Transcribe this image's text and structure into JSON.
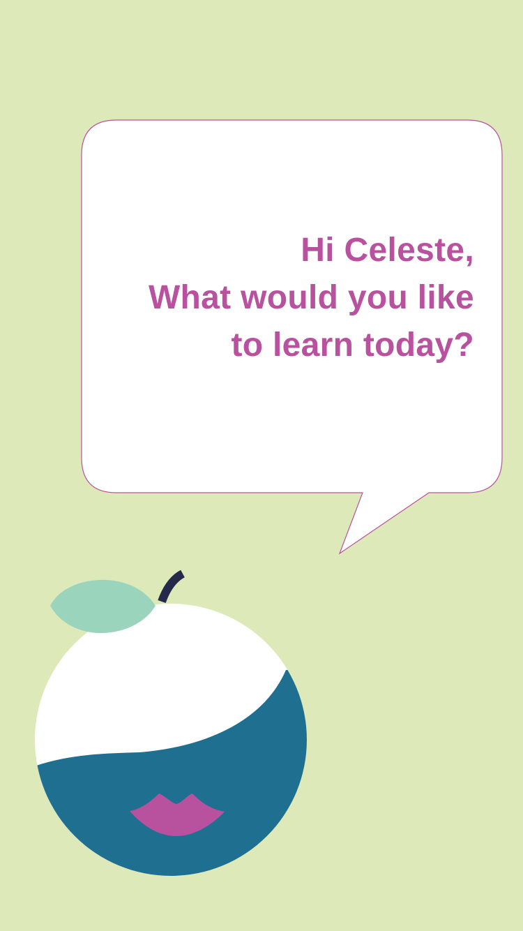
{
  "greeting": {
    "line1": "Hi Celeste,",
    "line2": "What would you like",
    "line3": "to learn today?"
  },
  "colors": {
    "background": "#dde9b9",
    "accent": "#b8529f",
    "bubble_fill": "#ffffff",
    "bubble_border": "#b8529f",
    "apple_dark": "#1f7090",
    "leaf": "#9bd4bd",
    "stem": "#262a4a"
  },
  "icons": {
    "speech_bubble": "speech-bubble-icon",
    "mascot": "apple-mascot-icon"
  }
}
